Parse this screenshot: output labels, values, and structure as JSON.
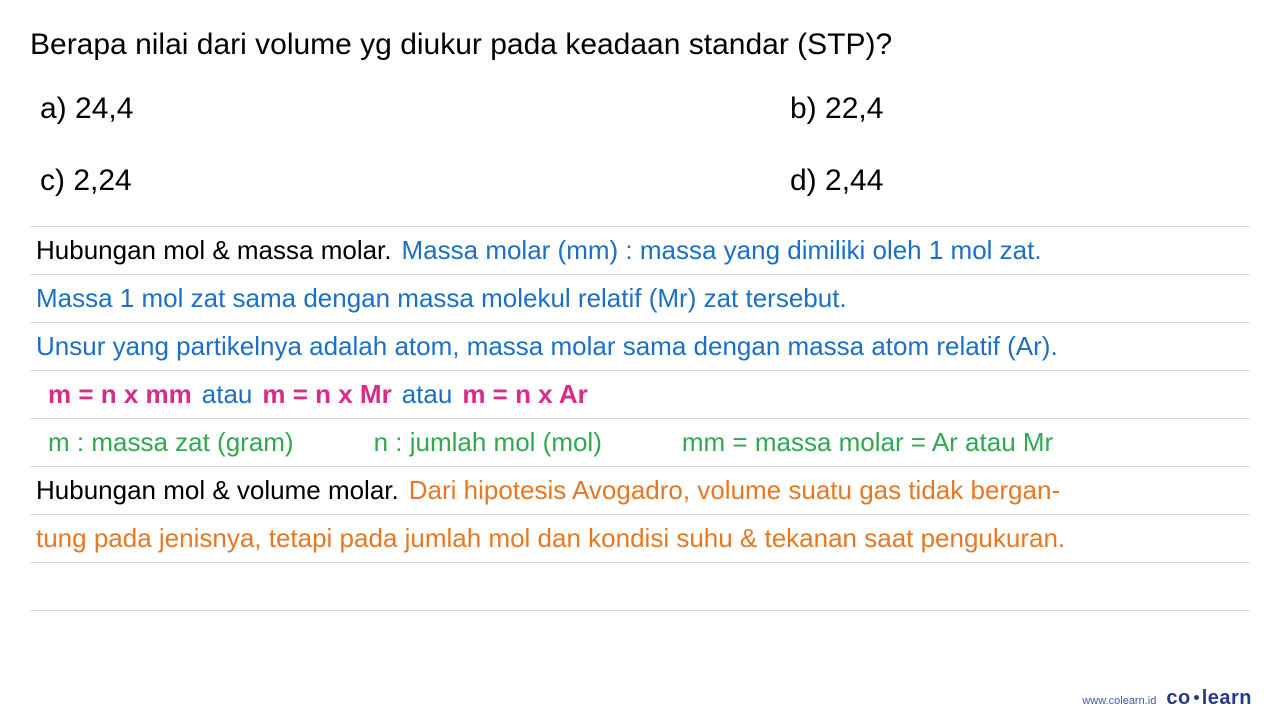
{
  "question": "Berapa nilai dari volume yg diukur pada keadaan standar (STP)?",
  "options": {
    "a": "a)  24,4",
    "b": "b)  22,4",
    "c": "c)  2,24",
    "d": "d)  2,44"
  },
  "lines": {
    "l1_black": "Hubungan mol & massa molar.  ",
    "l1_blue": "Massa molar (mm) : massa yang dimiliki oleh 1 mol zat.",
    "l2_blue": "Massa 1 mol zat sama dengan massa molekul relatif (Mr) zat tersebut.",
    "l3_blue": "Unsur yang partikelnya adalah atom, massa molar sama dengan massa atom relatif (Ar).",
    "l4_p1": "m = n x mm",
    "l4_b1": "atau",
    "l4_p2": "m = n x Mr",
    "l4_b2": "atau",
    "l4_p3": "m = n x Ar",
    "l5_g1": "m : massa zat (gram)",
    "l5_g2": "n : jumlah mol (mol)",
    "l5_g3": "mm = massa molar = Ar atau Mr",
    "l6_black": "Hubungan mol & volume molar. ",
    "l6_orange": "Dari hipotesis Avogadro, volume suatu gas tidak bergan-",
    "l7_orange": "tung pada jenisnya, tetapi pada jumlah mol dan kondisi suhu & tekanan saat pengukuran."
  },
  "footer": {
    "url": "www.colearn.id",
    "brand_left": "co",
    "brand_right": "learn"
  }
}
